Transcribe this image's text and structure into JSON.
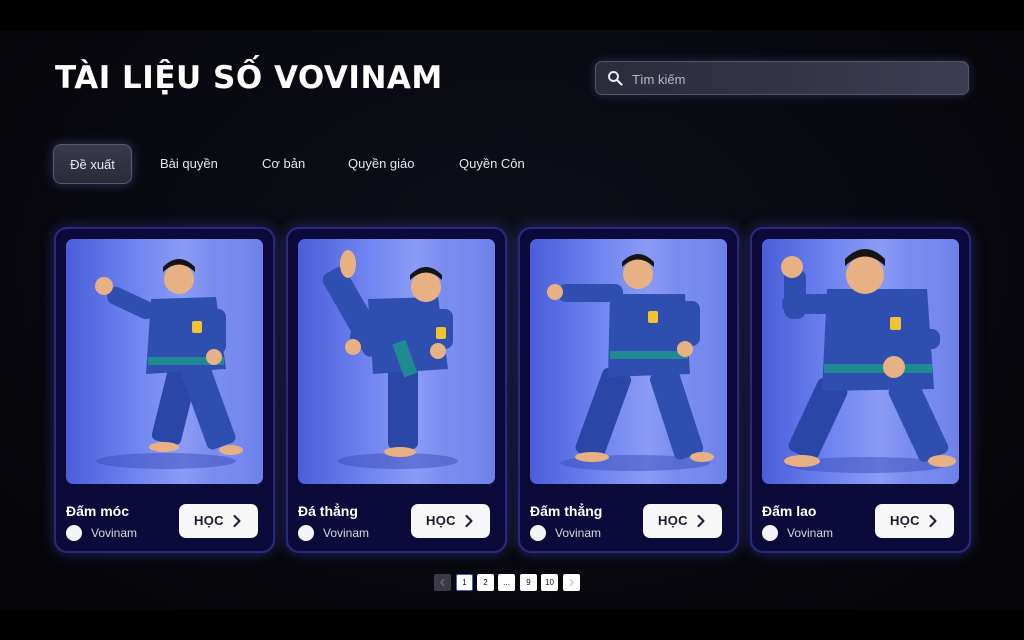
{
  "header": {
    "title": "TÀI LIỆU SỐ VOVINAM"
  },
  "search": {
    "placeholder": "Tìm kiếm",
    "icon": "search-icon"
  },
  "tabs": [
    {
      "label": "Đề xuất",
      "active": true
    },
    {
      "label": "Bài quyền",
      "active": false
    },
    {
      "label": "Cơ bản",
      "active": false
    },
    {
      "label": "Quyền giáo",
      "active": false
    },
    {
      "label": "Quyền Côn",
      "active": false
    }
  ],
  "cards": [
    {
      "title": "Đấm móc",
      "author": "Vovinam",
      "button_label": "HỌC"
    },
    {
      "title": "Đá thẳng",
      "author": "Vovinam",
      "button_label": "HỌC"
    },
    {
      "title": "Đấm thẳng",
      "author": "Vovinam",
      "button_label": "HỌC"
    },
    {
      "title": "Đấm lao",
      "author": "Vovinam",
      "button_label": "HỌC"
    }
  ],
  "pagination": {
    "pages": [
      "1",
      "2",
      "...",
      "9",
      "10"
    ],
    "current": "1",
    "prev_icon": "chevron-left-icon",
    "next_icon": "chevron-right-icon"
  },
  "colors": {
    "card_border": "#2b2a7e",
    "card_background": "#0b0a3a",
    "image_background": "#6f84f0",
    "gi_blue": "#2f4fb0",
    "belt_teal": "#1f8a92"
  }
}
